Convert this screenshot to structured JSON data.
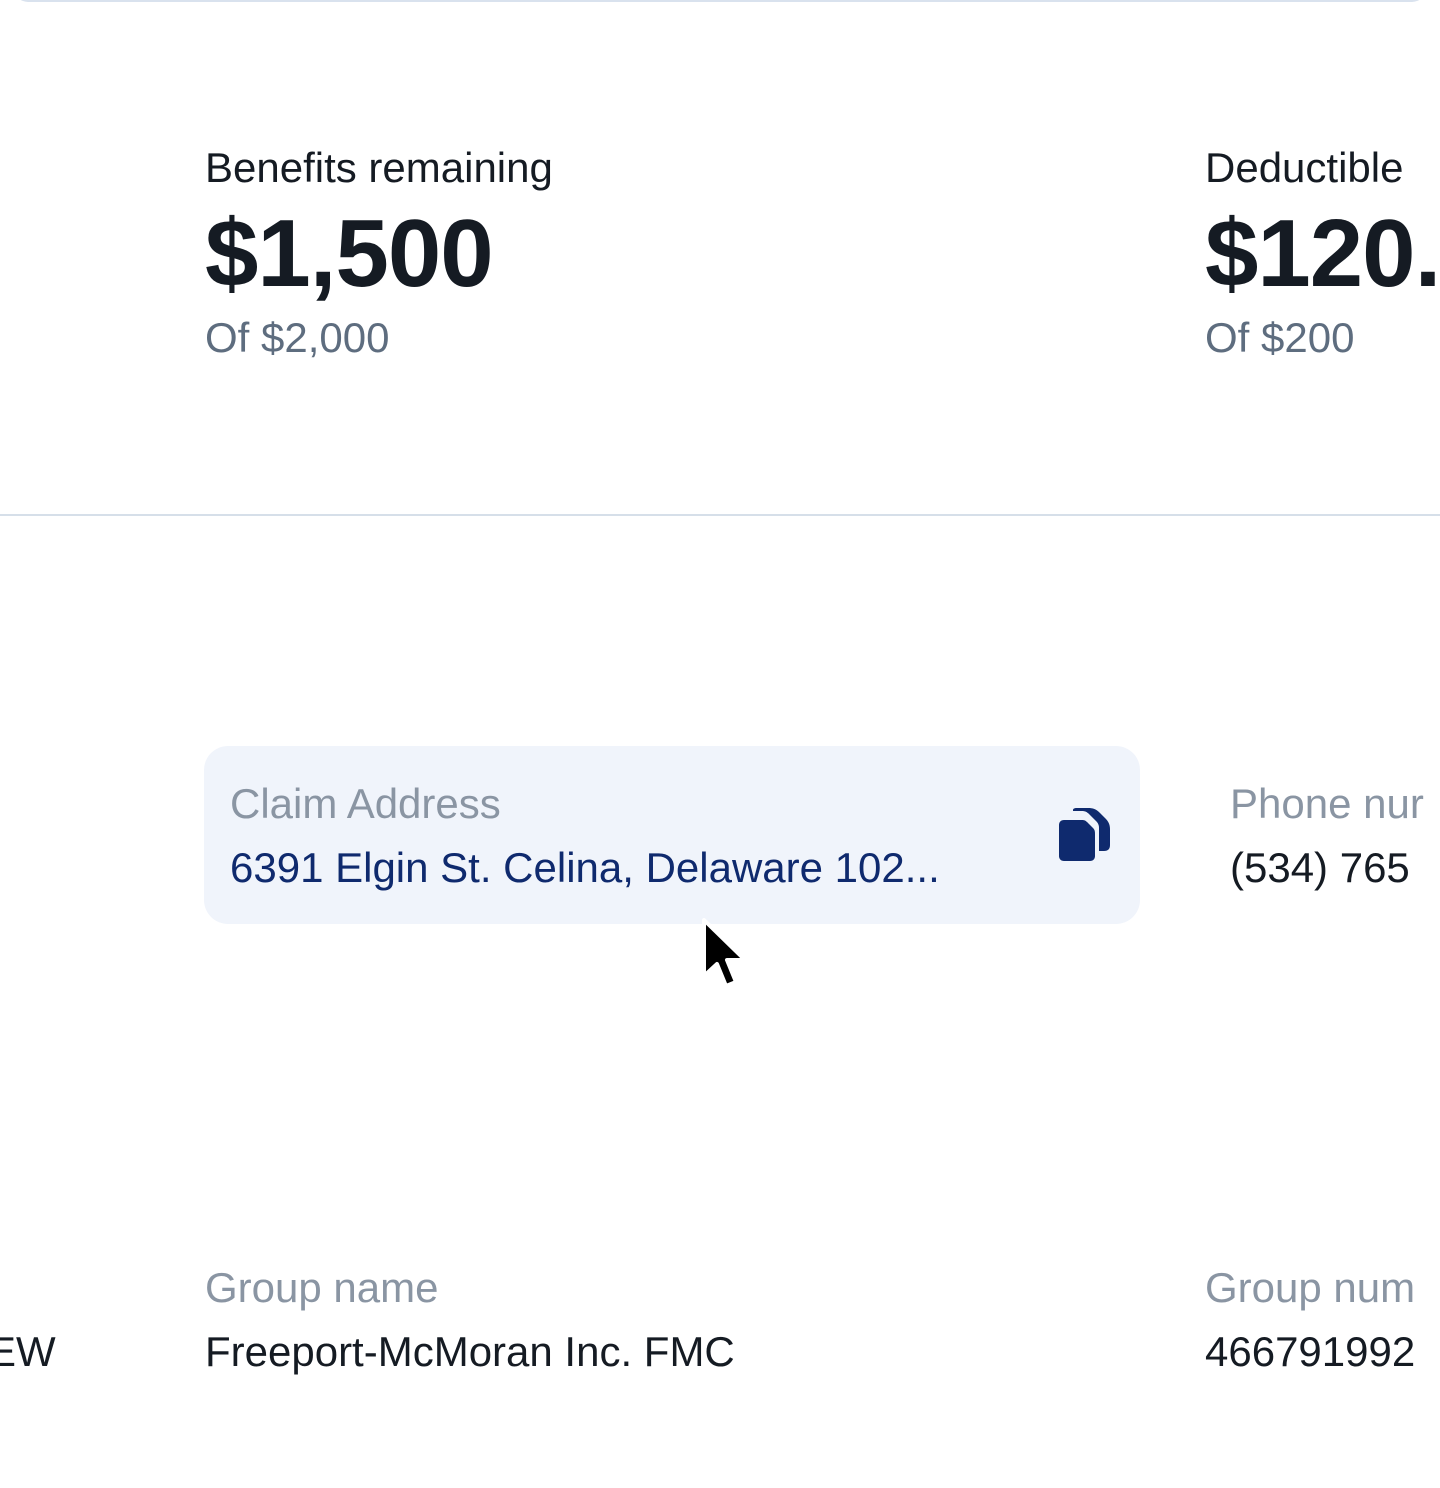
{
  "benefits": {
    "label": "Benefits remaining",
    "amount": "$1,500",
    "total": "Of $2,000"
  },
  "deductible": {
    "label": "Deductible",
    "amount": "$120.",
    "total": "Of $200"
  },
  "claim_address": {
    "label": "Claim Address",
    "value": "6391 Elgin St. Celina, Delaware 102...",
    "copy_icon": "copy-icon",
    "accent_color": "#0f2a6e",
    "background": "#f0f4fb"
  },
  "phone": {
    "label": "Phone nur",
    "value": "(534) 765"
  },
  "group_name": {
    "label": "Group name",
    "value": "Freeport-McMoran Inc. FMC"
  },
  "group_number": {
    "label": "Group num",
    "value": "466791992"
  },
  "left_fragment": "EW",
  "cursor_icon": "mouse-pointer-icon"
}
